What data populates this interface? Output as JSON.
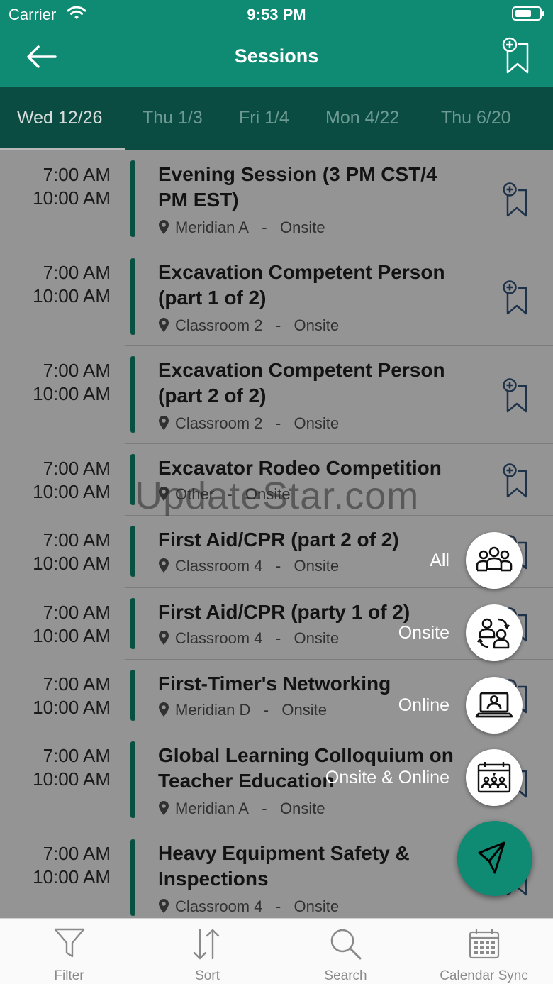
{
  "status_bar": {
    "carrier": "Carrier",
    "time": "9:53 PM"
  },
  "header": {
    "title": "Sessions"
  },
  "date_tabs": [
    {
      "label": "Wed 12/26",
      "active": true
    },
    {
      "label": "Thu 1/3",
      "active": false
    },
    {
      "label": "Fri 1/4",
      "active": false
    },
    {
      "label": "Mon 4/22",
      "active": false
    },
    {
      "label": "Thu 6/20",
      "active": false
    }
  ],
  "sessions": [
    {
      "start": "7:00 AM",
      "end": "10:00 AM",
      "title": "Evening Session (3 PM CST/4 PM EST)",
      "room": "Meridian A",
      "separator": "-",
      "mode": "Onsite"
    },
    {
      "start": "7:00 AM",
      "end": "10:00 AM",
      "title": "Excavation Competent Person (part 1 of 2)",
      "room": "Classroom 2",
      "separator": "-",
      "mode": "Onsite"
    },
    {
      "start": "7:00 AM",
      "end": "10:00 AM",
      "title": "Excavation Competent Person (part 2 of 2)",
      "room": "Classroom 2",
      "separator": "-",
      "mode": "Onsite"
    },
    {
      "start": "7:00 AM",
      "end": "10:00 AM",
      "title": "Excavator Rodeo Competition",
      "room": "Other",
      "separator": "-",
      "mode": "Onsite"
    },
    {
      "start": "7:00 AM",
      "end": "10:00 AM",
      "title": "First Aid/CPR (part 2 of 2)",
      "room": "Classroom 4",
      "separator": "-",
      "mode": "Onsite"
    },
    {
      "start": "7:00 AM",
      "end": "10:00 AM",
      "title": "First Aid/CPR (party 1 of 2)",
      "room": "Classroom 4",
      "separator": "-",
      "mode": "Onsite"
    },
    {
      "start": "7:00 AM",
      "end": "10:00 AM",
      "title": "First-Timer's Networking",
      "room": "Meridian D",
      "separator": "-",
      "mode": "Onsite"
    },
    {
      "start": "7:00 AM",
      "end": "10:00 AM",
      "title": "Global Learning Colloquium on Teacher Education",
      "room": "Meridian A",
      "separator": "-",
      "mode": "Onsite"
    },
    {
      "start": "7:00 AM",
      "end": "10:00 AM",
      "title": "Heavy Equipment Safety & Inspections",
      "room": "Classroom 4",
      "separator": "-",
      "mode": "Onsite"
    }
  ],
  "watermark": "UpdateStar.com",
  "filter_menu": [
    {
      "label": "All",
      "icon": "group-icon"
    },
    {
      "label": "Onsite",
      "icon": "onsite-people-icon"
    },
    {
      "label": "Online",
      "icon": "laptop-user-icon"
    },
    {
      "label": "Onsite & Online",
      "icon": "calendar-audience-icon"
    }
  ],
  "bottom_bar": [
    {
      "label": "Filter",
      "icon": "filter-icon"
    },
    {
      "label": "Sort",
      "icon": "sort-icon"
    },
    {
      "label": "Search",
      "icon": "search-icon"
    },
    {
      "label": "Calendar Sync",
      "icon": "calendar-icon"
    }
  ],
  "colors": {
    "brand": "#0f8a73",
    "tab_bar": "#0a4c42",
    "accent_bar": "#0f8a73",
    "icon_blue": "#34577e"
  }
}
